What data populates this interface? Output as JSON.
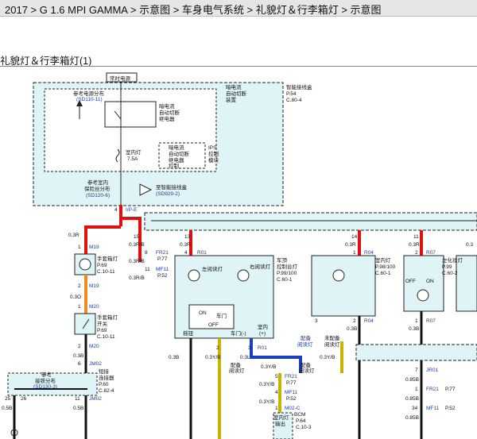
{
  "breadcrumb": "2017 > G 1.6 MPI GAMMA > 示意图 > 车身电气系统 > 礼貌灯＆行李箱灯 > 示意图",
  "section_title": "礼貌灯＆行李箱灯(1)",
  "colors": {
    "red_wire": "#e01010",
    "orange_wire": "#f08a1a",
    "blue_wire": "#1840c0",
    "yellow_wire": "#c8b400",
    "box_fill": "#dff4f6",
    "ref_blue": "#1a3aa8"
  },
  "labels": {
    "always_power": "常时电源",
    "ref_power_dist": "参考电源分布",
    "ref_power_code": "(SD110-11)",
    "smart_junction": "智能接线盒",
    "smart_junction_page": "P.54",
    "smart_junction_code": "C.80-4",
    "dark_current_device_1": "暗电流",
    "dark_current_device_2": "自动切断",
    "dark_current_device_3": "装置",
    "relay_1": "暗电流",
    "relay_2": "自动切断",
    "relay_3": "继电器",
    "ips_1": "暗电流",
    "ips_2": "自动切断",
    "ips_3": "继电器",
    "ips_4": "控制",
    "ips_side_1": "IPS",
    "ips_side_2": "控制",
    "ips_side_3": "模块",
    "room_lamp_fuse_1": "室内灯",
    "room_lamp_fuse_2": "7.5A",
    "ref_fuse_1": "参考室内",
    "ref_fuse_2": "保险丝分布",
    "ref_fuse_code": "(SD120-6)",
    "smart_jb_ref": "至智能接线盒",
    "smart_jb_ref_code": "(SD929-2)",
    "ipe_pin": "4",
    "ipe": "I/P-E",
    "w_03r_a": "0.3R",
    "m19_pin": "1",
    "m19": "M19",
    "glove_lamp_1": "手套箱灯",
    "glove_lamp_page": "P.69",
    "glove_lamp_code": "C.10-11",
    "m19b_pin": "2",
    "m19b": "M19",
    "w_03o": "0.3O",
    "m20_pin": "1",
    "m20": "M20",
    "glove_sw_1": "手套箱灯",
    "glove_sw_2": "开关",
    "glove_sw_page": "P.69",
    "glove_sw_code": "C.10-11",
    "m20b_pin": "2",
    "m20b": "M20",
    "w_03b": "0.3B",
    "jm02_pin": "6",
    "jm02": "JM02",
    "short_conn_1": "短接",
    "short_conn_2": "连接器",
    "short_conn_page": "P.60",
    "short_conn_code": "C.82-4",
    "ref_ground_1": "参考",
    "ref_ground_2": "接铁分布",
    "ref_ground_code": "(SD130-3)",
    "p25": "25",
    "p26": "26",
    "p11": "11",
    "jm02b": "JM02",
    "w_05b_a": "0.5B",
    "w_05b_b": "0.5B",
    "p15": "15",
    "w_03rvb_1": "0.3R/B",
    "p8": "8",
    "fr21": "FR21",
    "p77": "P.77",
    "w_03rvb_2": "0.3R/B",
    "p11b": "11",
    "mf11": "MF11",
    "p52": "P.52",
    "w_03rvb_3": "0.3R/B",
    "p13": "13",
    "w_03r_b": "0.3R",
    "p4": "4",
    "r01": "R01",
    "roof_1": "车顶",
    "roof_2": "控制台灯",
    "roof_page": "P.99/100",
    "roof_code": "C.60-1",
    "left_read": "左阅读灯",
    "right_read": "右阅读灯",
    "on": "ON",
    "door": "车门",
    "off": "OFF",
    "sw_lbl": "摇钮",
    "door_neg": "车门(-)",
    "room_pos_1": "室内",
    "room_pos_2": "(+)",
    "p2": "2",
    "p3": "3",
    "r01b": "R01",
    "w_03yb_a": "0.3Y/B",
    "w_03l": "0.3L",
    "w_03b_a": "0.3B",
    "with_lamp_1": "配备",
    "with_lamp_2": "阅读灯",
    "without_lamp_1": "未配备",
    "without_lamp_2": "阅读灯",
    "w_03yb_b": "0.3Y/B",
    "w_03yb_c": "0.3Y/B",
    "p5": "5",
    "fr21b": "FR21",
    "p77b": "P.77",
    "w_03yb_d": "0.3Y/B",
    "p4b": "4",
    "mf11b": "MF11",
    "p52b": "P.52",
    "w_03yb_e": "0.3Y/B",
    "p1": "1",
    "m02c": "M02-C",
    "bcm": "BCM",
    "bcm_out_1": "室内灯",
    "bcm_out_2": "输出",
    "bcm_page": "P.64",
    "bcm_code": "C.10-3",
    "p14": "14",
    "w_03r_c": "0.3R",
    "p1b": "1",
    "r04": "R04",
    "room_lamp_1": "室内灯",
    "room_lamp_page": "P.98/100",
    "room_lamp_code": "C.60-1",
    "p3b": "3",
    "p2b": "2",
    "r04b": "R04",
    "w_03b_b": "0.3B",
    "p11c": "11",
    "w_03r_d": "0.3R",
    "p2c": "2",
    "r07": "R07",
    "vanity_1": "左化妆灯",
    "vanity_page": "P.99",
    "vanity_code": "C.60-2",
    "off2": "OFF",
    "on2": "ON",
    "p1c": "1",
    "r07b": "R07",
    "w_03b_c": "0.3B",
    "p7": "7",
    "jr01": "JR01",
    "w_085b_1": "0.85B",
    "p1d": "1",
    "fr21c": "FR21",
    "p77c": "P.77",
    "w_085b_2": "0.85B",
    "p34": "34",
    "mf11c": "MF11",
    "p52c": "P.52",
    "w_085b_3": "0.85B",
    "w_03_right": "0.3"
  }
}
